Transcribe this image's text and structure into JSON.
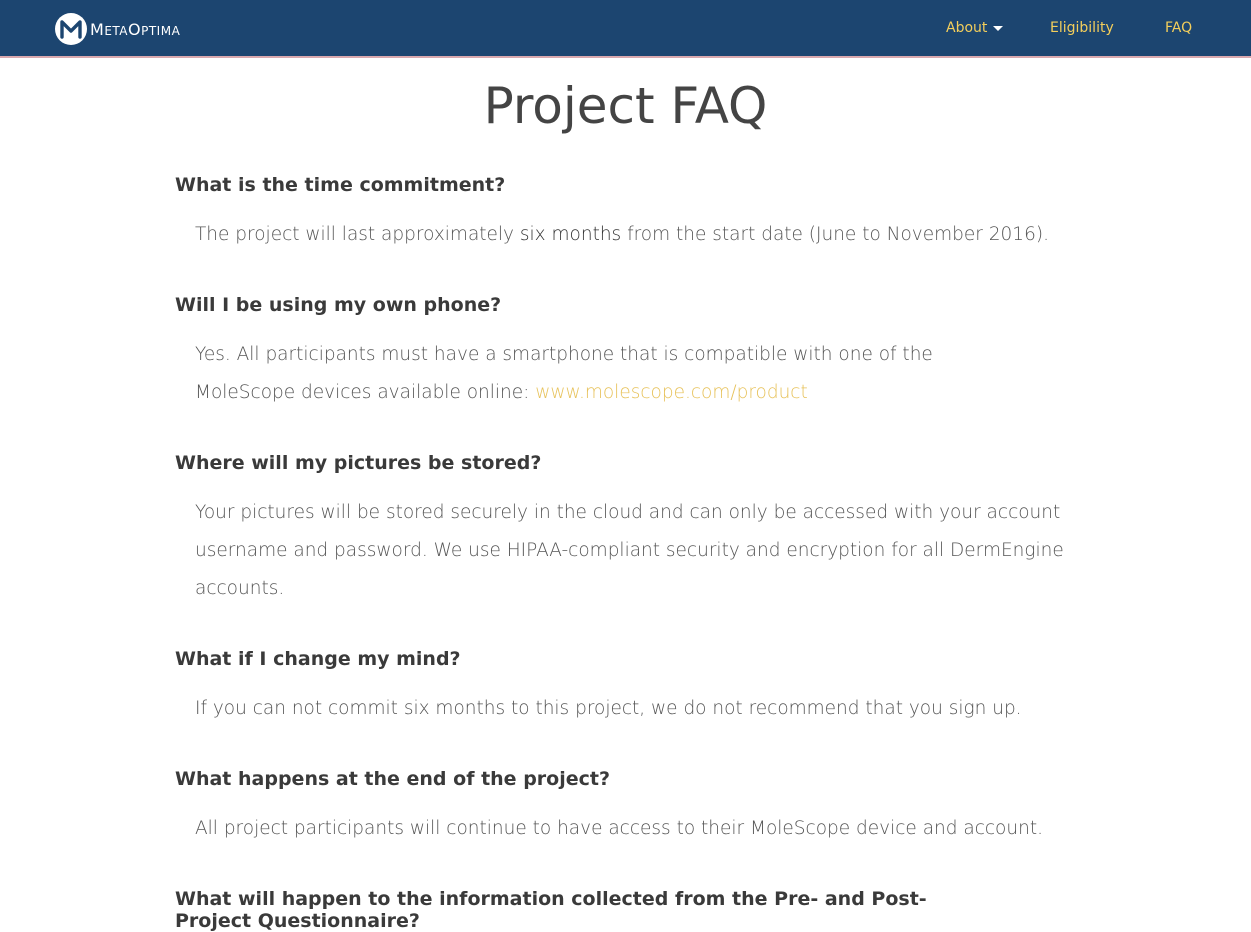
{
  "header": {
    "brand": {
      "logo_letter": "M",
      "name_first": "M",
      "name_rest_1": "ETA",
      "name_mid": "O",
      "name_rest_2": "PTIMA"
    },
    "nav": [
      {
        "label": "About",
        "has_dropdown": true
      },
      {
        "label": "Eligibility"
      },
      {
        "label": "FAQ"
      }
    ],
    "colors": {
      "bar": "#1c4570",
      "link": "#f3ce5b"
    }
  },
  "main": {
    "title": "Project FAQ",
    "faqs": [
      {
        "question": "What is the time commitment?",
        "answer_pre": "The project will last approximately ",
        "answer_em": "six months",
        "answer_post": " from the start date (June to November 2016)."
      },
      {
        "question": "Will I be using my own phone?",
        "answer_pre": "Yes. All participants must have a smartphone that is compatible with one of the MoleScope devices available online: ",
        "answer_link": "www.molescope.com/product"
      },
      {
        "question": "Where will my pictures be stored?",
        "answer": "Your pictures will be stored securely in the cloud and can only be accessed with your account username and password. We use HIPAA-compliant security and encryption for all DermEngine accounts."
      },
      {
        "question": "What if I change my mind?",
        "answer": "If you can not commit six months to this project, we do not recommend that you sign up."
      },
      {
        "question": "What happens at the end of the project?",
        "answer": "All project participants will continue to have access to their MoleScope device and account."
      },
      {
        "question": "What will happen to the information collected from the Pre- and Post-Project Questionnaire?"
      }
    ]
  }
}
